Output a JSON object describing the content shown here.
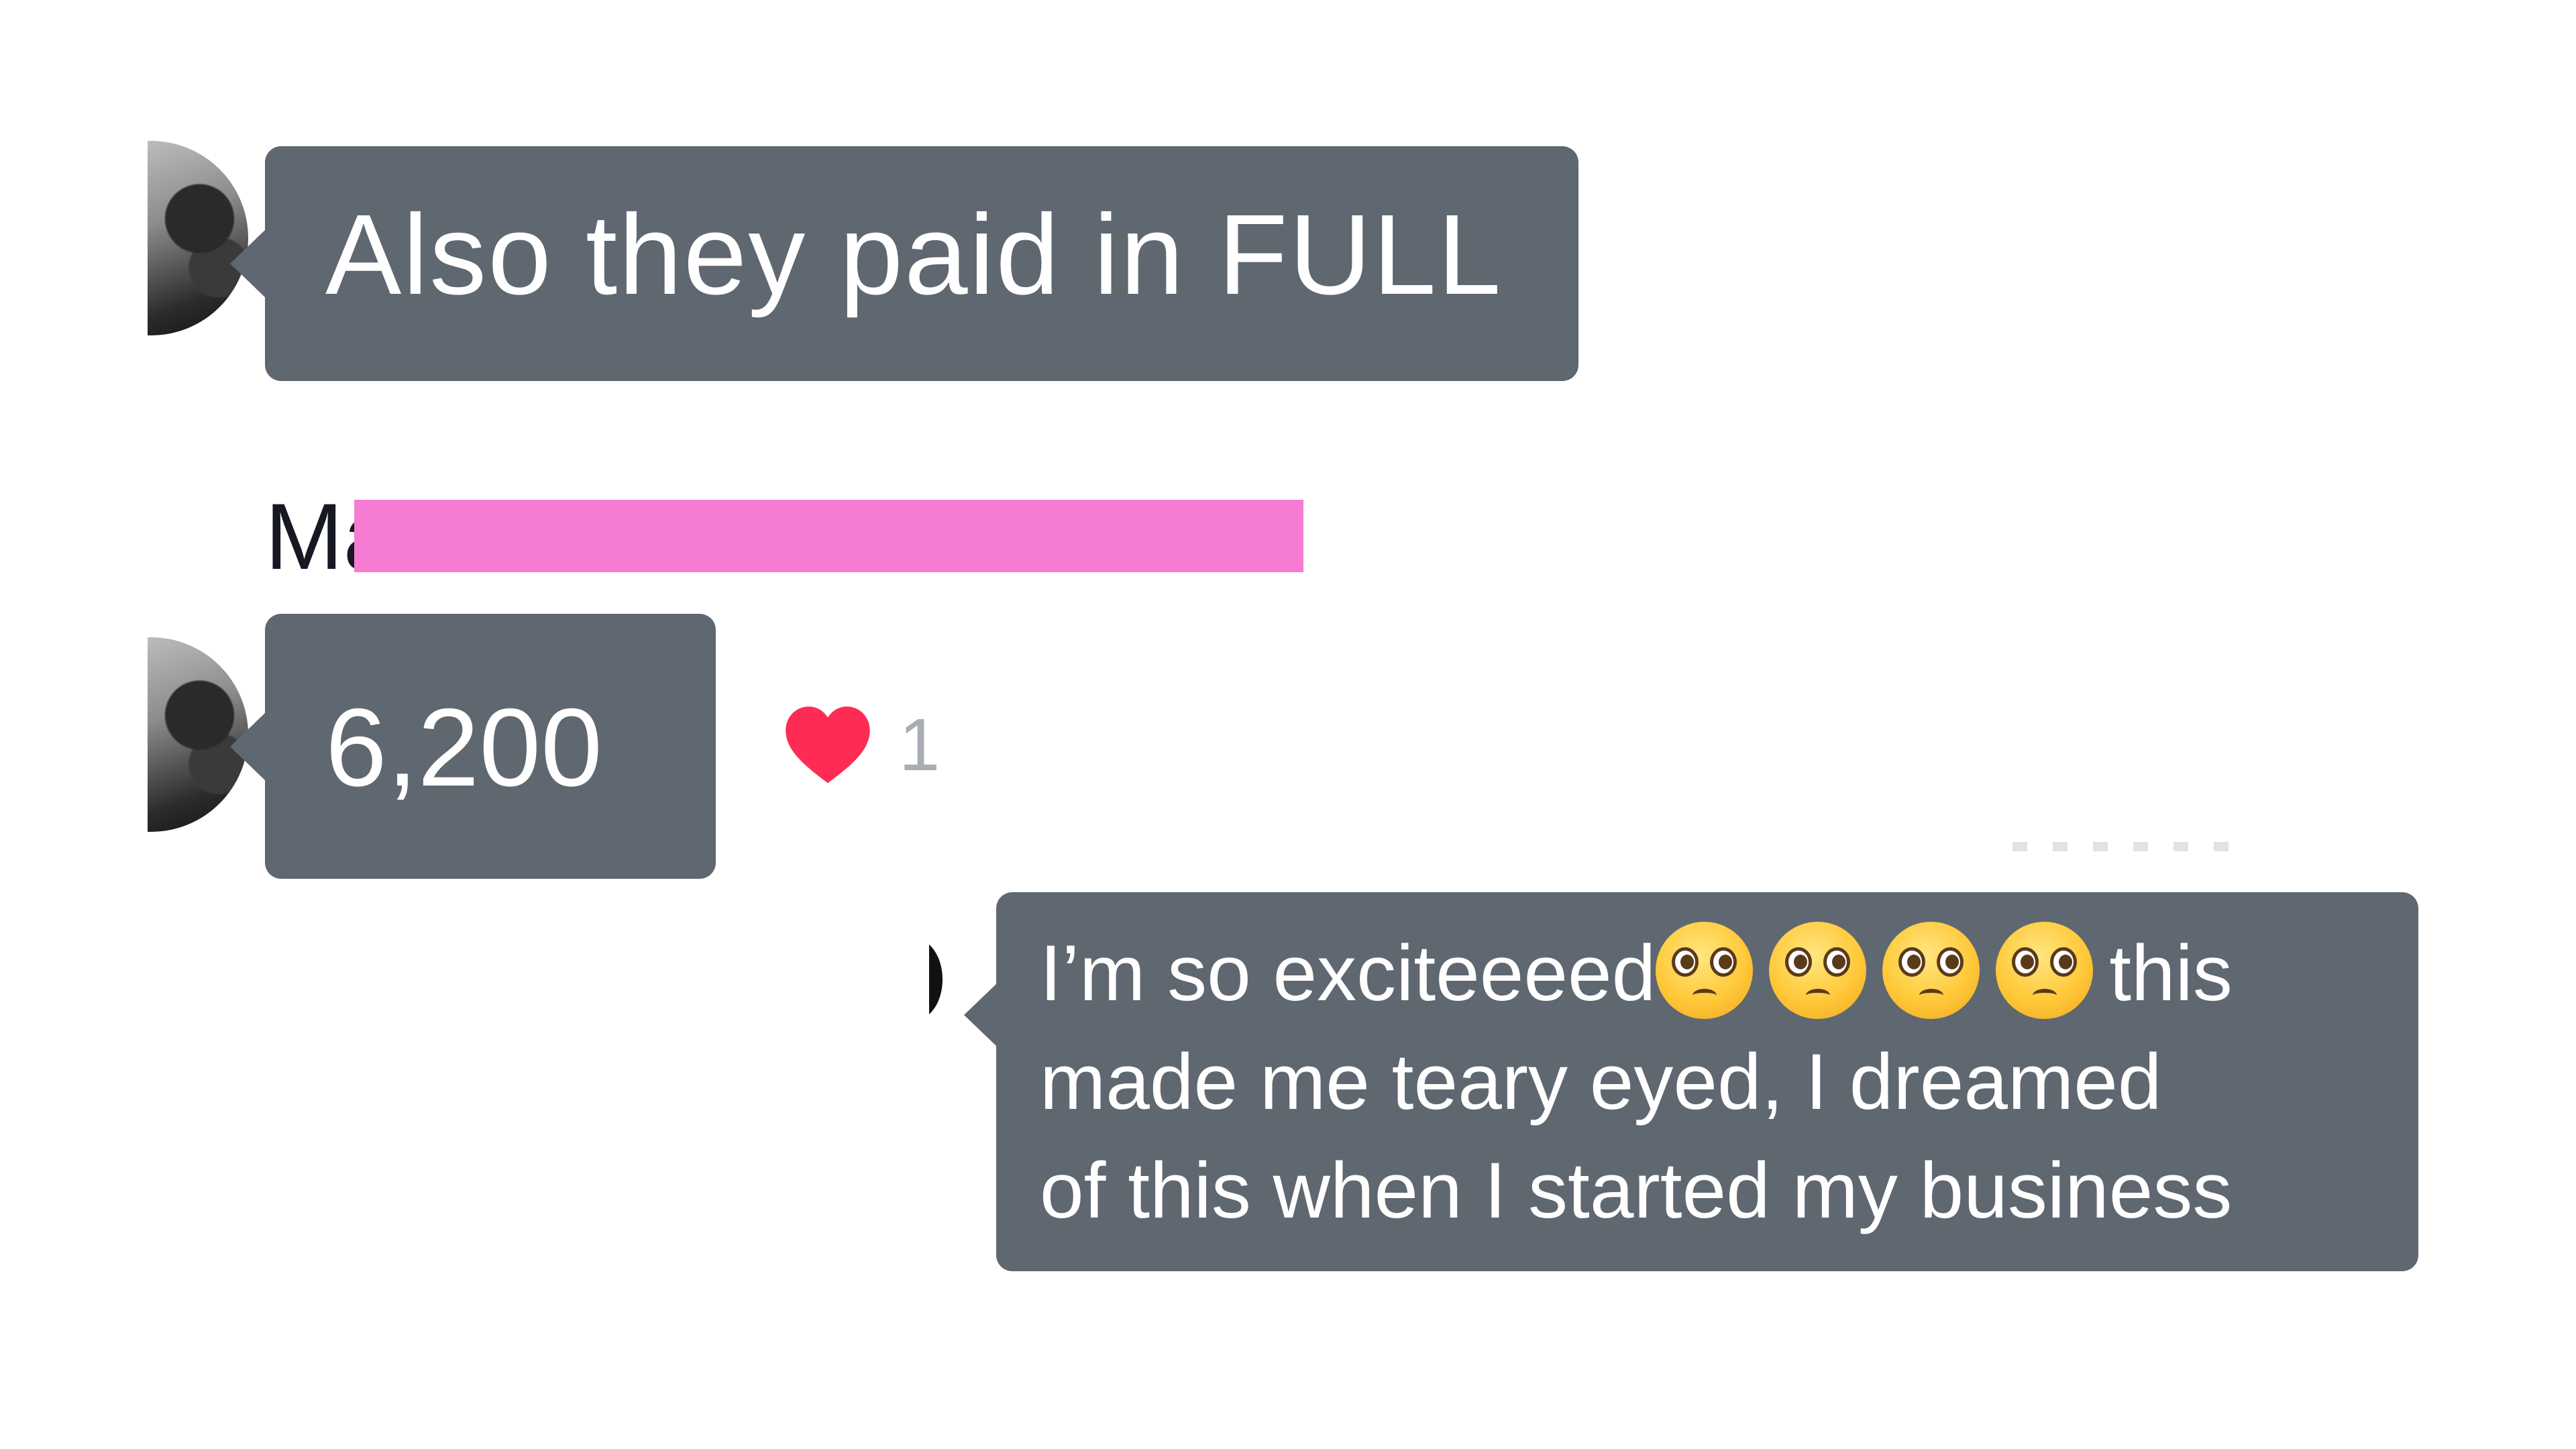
{
  "messages": [
    {
      "id": "msg1",
      "text": "Also they paid in FULL",
      "sender": "other"
    },
    {
      "id": "msg2",
      "text": "6,200",
      "sender": "other",
      "reaction": {
        "icon": "heart-icon",
        "color": "#fe2c55",
        "count": "1"
      }
    },
    {
      "id": "msg3",
      "sender": "self",
      "line1_before": "I’m so exciteeeed",
      "line1_after": "this",
      "emoji": [
        "pleading-face-icon",
        "pleading-face-icon",
        "pleading-face-icon",
        "pleading-face-icon"
      ],
      "line2": "made me teary eyed, I dreamed",
      "line3": "of this when I started my business"
    }
  ],
  "sender_label": {
    "visible_prefix": "Ma",
    "redaction_color": "#f67bd2"
  },
  "colors": {
    "bubble": "#5f6770",
    "bubble_text": "#ffffff",
    "heart": "#fe2c55"
  }
}
